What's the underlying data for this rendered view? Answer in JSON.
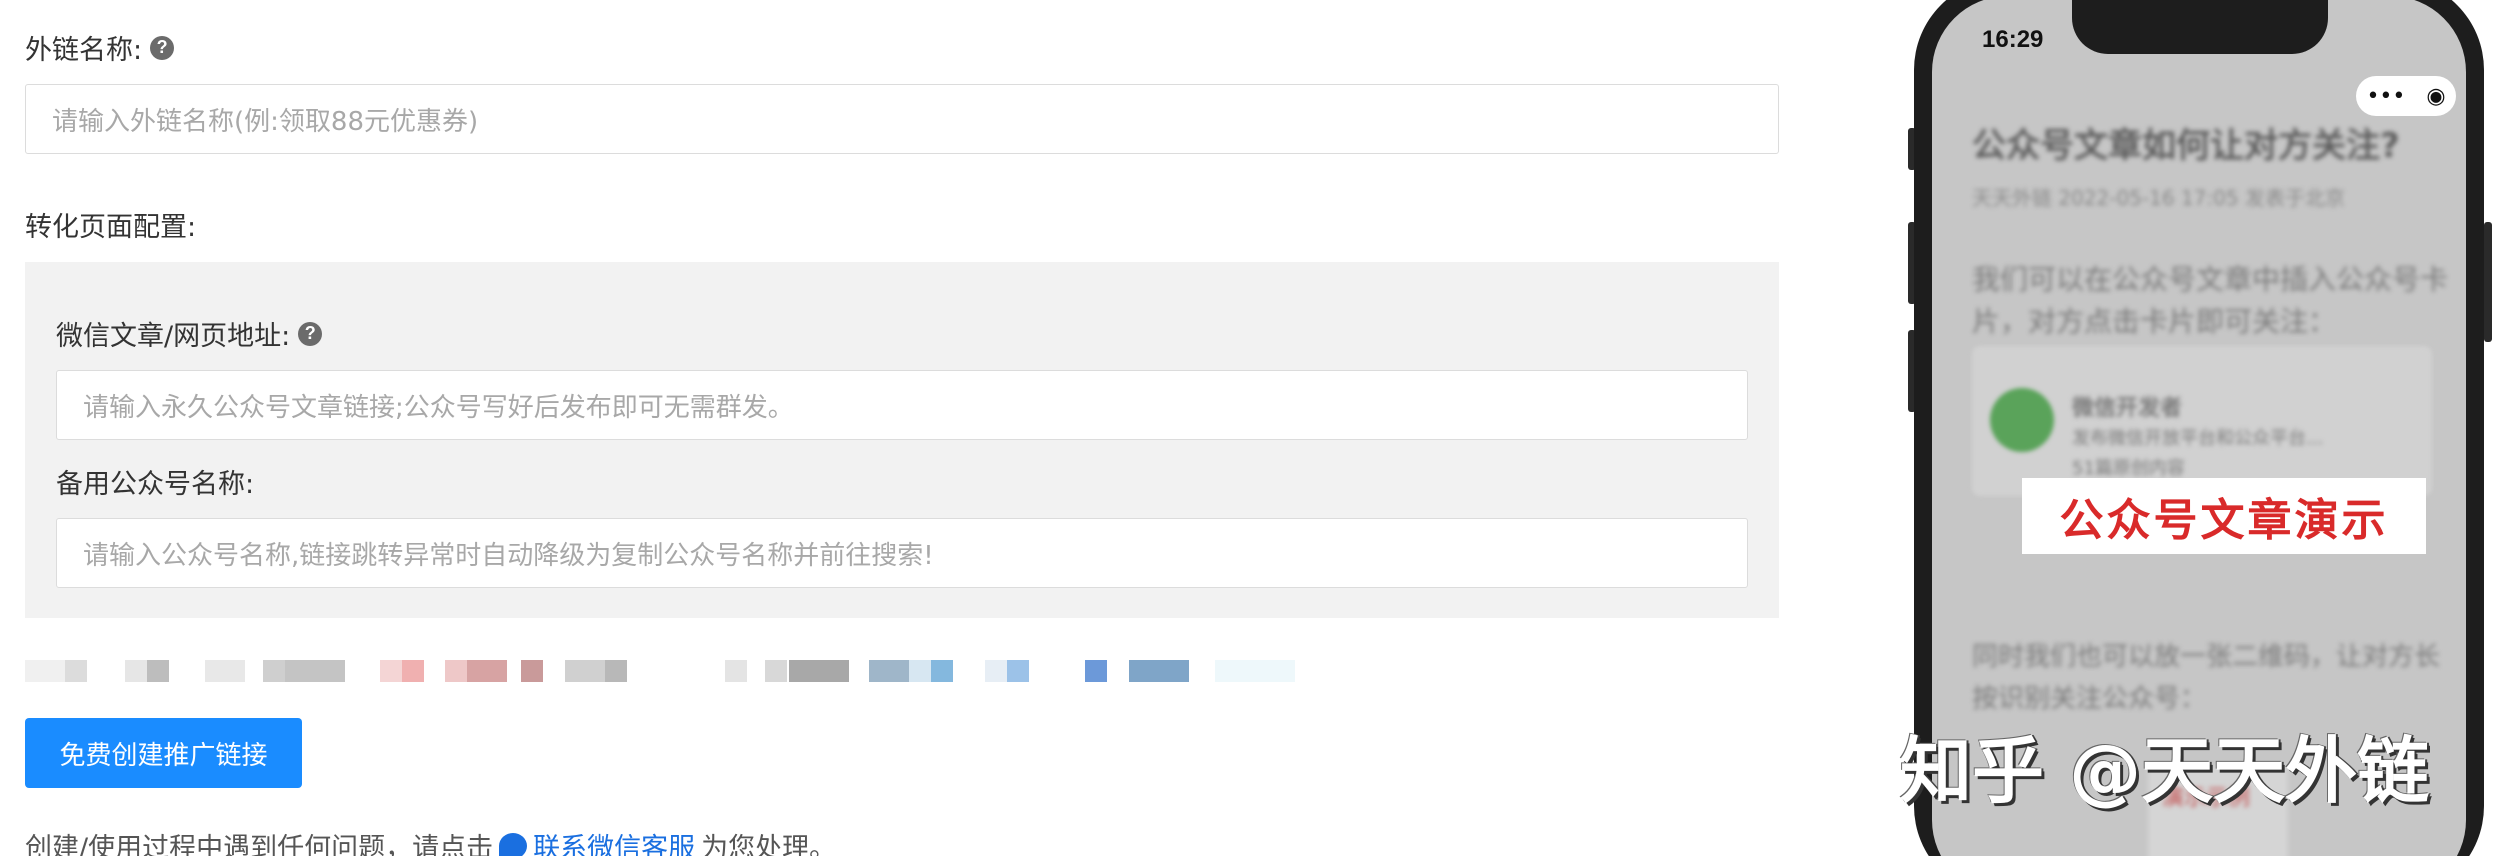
{
  "form": {
    "link_name_label": "外链名称:",
    "link_name_placeholder": "请输入外链名称(例:领取88元优惠券)",
    "conversion_label": "转化页面配置:",
    "article_url_label": "微信文章/网页地址:",
    "article_url_placeholder": "请输入永久公众号文章链接;公众号写好后发布即可无需群发。",
    "backup_name_label": "备用公众号名称:",
    "backup_name_placeholder": "请输入公众号名称,链接跳转异常时自动降级为复制公众号名称并前往搜索!",
    "submit_label": "免费创建推广链接",
    "help_prefix": "创建/使用过程中遇到任何问题，请点击",
    "help_link": "联系微信客服",
    "help_suffix": "为您处理。"
  },
  "icons": {
    "help": "question-circle-icon",
    "chat": "chat-bubble-icon"
  },
  "colors": {
    "primary": "#1a8cff",
    "link": "#1a6fe0",
    "panel_bg": "#f2f2f2",
    "demo_red": "#d92a2a"
  },
  "phone": {
    "time": "16:29",
    "capsule_more": "•••",
    "capsule_target": "◉",
    "article_title": "公众号文章如何让对方关注?",
    "article_meta": "天天外链 2022-05-16 17:05 发表于北京",
    "article_para1_line1": "我们可以在公众号文章中插入公众号卡",
    "article_para1_line2": "片，对方点击卡片即可关注：",
    "card_title": "微信开发者",
    "card_desc": "发布微信开放平台和公众平台...",
    "card_count": "51篇原创内容",
    "demo_label": "公众号文章演示",
    "article_para2_line1": "同时我们也可以放一张二维码，让对方长",
    "article_para2_line2": "按识别关注公众号：",
    "qr_caption": "演示示例"
  },
  "watermark": "知乎 @天天外链"
}
